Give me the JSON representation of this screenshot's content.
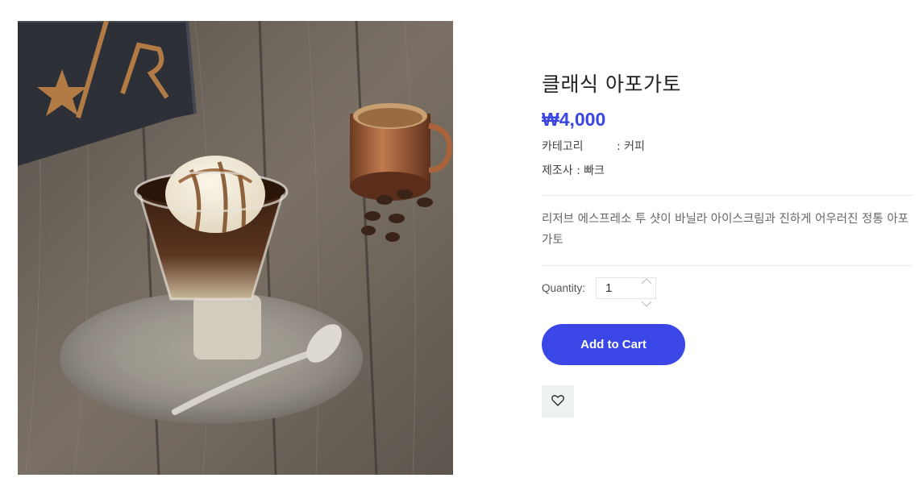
{
  "product": {
    "title": "클래식 아포가토",
    "price": "₩4,000",
    "category_label": "카테고리",
    "category_value": ": 커피",
    "maker_label": "제조사 : 빠크",
    "description": "리저브 에스프레소 투 샷이 바닐라 아이스크림과 진하게 어우러진 정통 아포가토",
    "image_alt": "클래식 아포가토 이미지"
  },
  "purchase": {
    "quantity_label": "Quantity:",
    "quantity_value": "1",
    "add_to_cart_label": "Add to Cart",
    "wishlist_icon": "heart-icon"
  },
  "colors": {
    "accent": "#3a46e6",
    "price": "#3b45e0",
    "wishlist_bg": "#eef1f2"
  }
}
